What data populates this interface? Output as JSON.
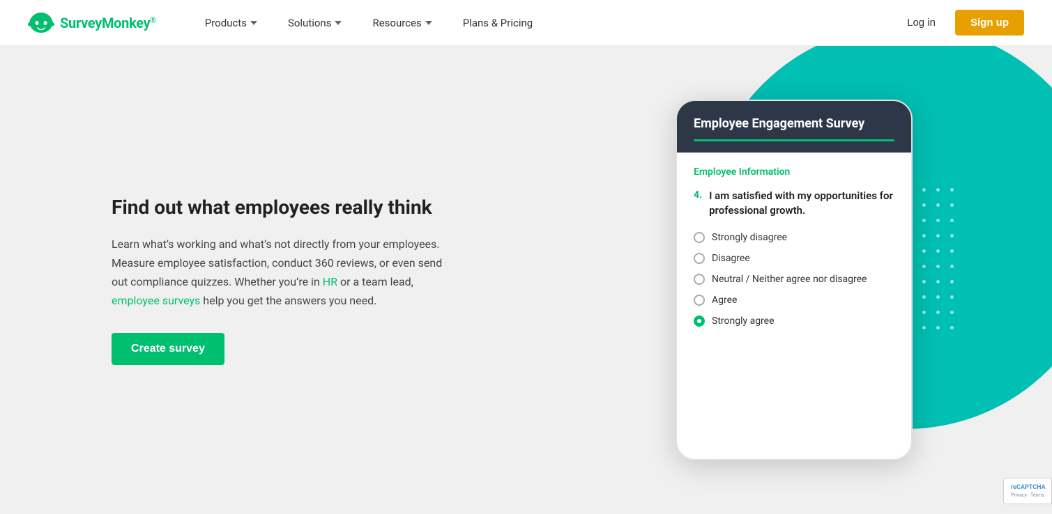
{
  "nav": {
    "logo_text": "SurveyMonkey",
    "logo_mark": "®",
    "links": [
      {
        "label": "Products",
        "has_dropdown": true
      },
      {
        "label": "Solutions",
        "has_dropdown": true
      },
      {
        "label": "Resources",
        "has_dropdown": true
      },
      {
        "label": "Plans & Pricing",
        "has_dropdown": false
      }
    ],
    "login_label": "Log in",
    "signup_label": "Sign up"
  },
  "hero": {
    "title": "Find out what employees really think",
    "body_part1": "Learn what’s working and what’s not directly from your employees. Measure employee satisfaction, conduct 360 reviews, or even send out compliance quizzes. Whether you’re in ",
    "link1_text": "HR",
    "body_part2": " or a team lead, ",
    "link2_text": "employee surveys",
    "body_part3": " help you get the answers you need.",
    "cta_label": "Create survey"
  },
  "survey_mockup": {
    "title": "Employee Engagement Survey",
    "section_title": "Employee Information",
    "question_number": "4.",
    "question_text": "I am satisfied with my opportunities for professional growth.",
    "options": [
      {
        "label": "Strongly disagree",
        "selected": false
      },
      {
        "label": "Disagree",
        "selected": false
      },
      {
        "label": "Neutral / Neither agree nor disagree",
        "selected": false
      },
      {
        "label": "Agree",
        "selected": false
      },
      {
        "label": "Strongly agree",
        "selected": true
      }
    ]
  },
  "recaptcha": {
    "text": "Privacy • Terms",
    "logo": "reCAPTCHA"
  }
}
